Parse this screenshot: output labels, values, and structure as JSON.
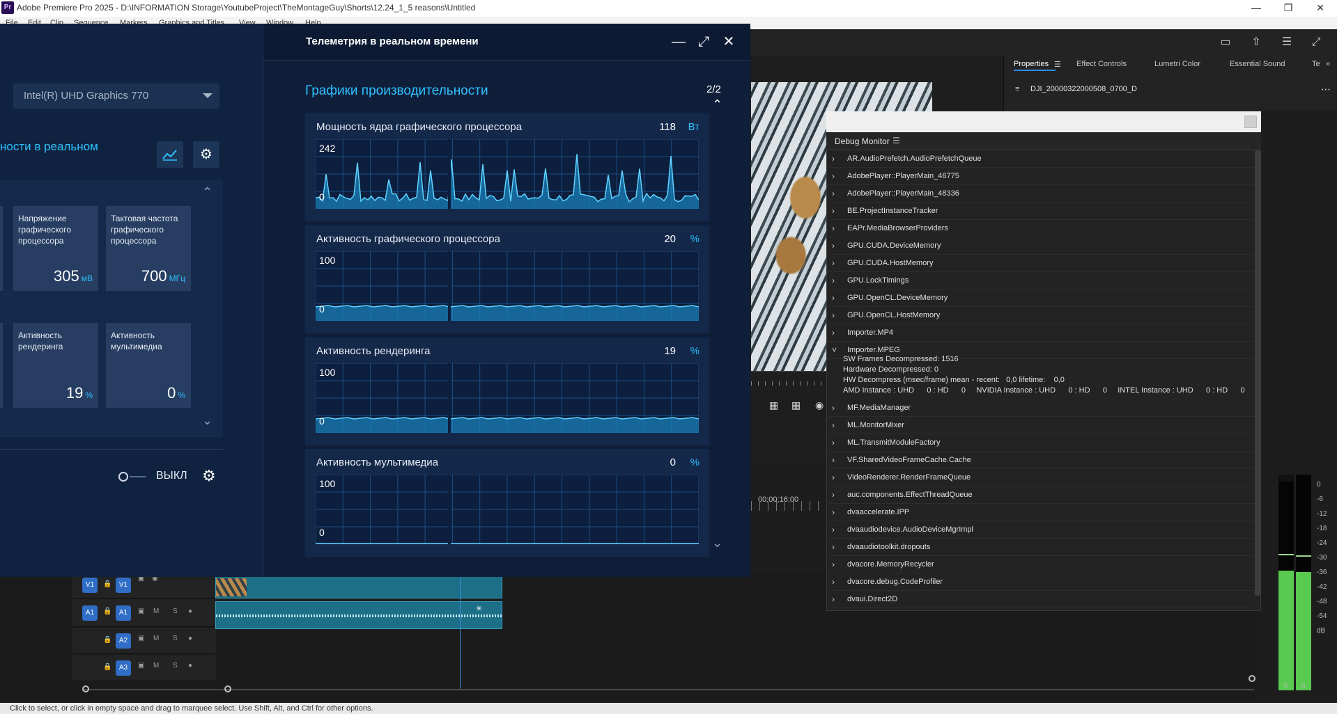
{
  "window": {
    "title": "Adobe Premiere Pro 2025 - D:\\INFORMATION Storage\\YoutubeProject\\TheMontageGuy\\Shorts\\12.24_1_5 reasons\\Untitled",
    "app_badge": "Pr"
  },
  "menu": [
    "File",
    "Edit",
    "Clip",
    "Sequence",
    "Markers",
    "Graphics and Titles",
    "View",
    "Window",
    "Help"
  ],
  "telemetry": {
    "window_title": "Телеметрия в реальном времени",
    "gpu_selected": "Intel(R) UHD Graphics 770",
    "left_subtitle": "ности в реальном",
    "metric_cards": [
      {
        "label": "Напряжение графического процессора",
        "value": "305",
        "unit": "мВ"
      },
      {
        "label": "Тактовая частота графического процессора",
        "value": "700",
        "unit": "МГц"
      },
      {
        "label": "Активность рендеринга",
        "value": "19",
        "unit": "%"
      },
      {
        "label": "Активность мультимедиа",
        "value": "0",
        "unit": "%"
      }
    ],
    "toggle_label": "ВЫКЛ",
    "perf_title": "Графики производительности",
    "page_indicator": "2/2",
    "graphs": [
      {
        "title": "Мощность ядра графического процессора",
        "value": "118",
        "unit": "Вт",
        "ymax": "242",
        "ymin": "0"
      },
      {
        "title": "Активность графического процессора",
        "value": "20",
        "unit": "%",
        "ymax": "100",
        "ymin": "0"
      },
      {
        "title": "Активность рендеринга",
        "value": "19",
        "unit": "%",
        "ymax": "100",
        "ymin": "0"
      },
      {
        "title": "Активность мультимедиа",
        "value": "0",
        "unit": "%",
        "ymax": "100",
        "ymin": "0"
      }
    ]
  },
  "properties": {
    "tabs": [
      "Properties",
      "Effect Controls",
      "Lumetri Color",
      "Essential Sound",
      "Te"
    ],
    "clip_name": "DJI_20000322000508_0700_D"
  },
  "debug": {
    "title": "Debug Monitor",
    "items_before": [
      "AR.AudioPrefetch.AudioPrefetchQueue",
      "AdobePlayer::PlayerMain_46775",
      "AdobePlayer::PlayerMain_48336",
      "BE.ProjectInstanceTracker",
      "EAPr.MediaBrowserProviders",
      "GPU.CUDA.DeviceMemory",
      "GPU.CUDA.HostMemory",
      "GPU.LockTimings",
      "GPU.OpenCL.DeviceMemory",
      "GPU.OpenCL.HostMemory",
      "Importer.MP4"
    ],
    "expanded_item": "Importer.MPEG",
    "expanded_details": [
      "SW Frames Decompressed: 1516",
      "Hardware Decompressed: 0",
      "HW Decompress (msec/frame) mean - recent:   0,0 lifetime:    0,0",
      "AMD Instance : UHD      0 : HD      0     NVIDIA Instance : UHD      0 : HD      0     INTEL Instance : UHD      0 : HD      0"
    ],
    "items_after": [
      "MF.MediaManager",
      "ML.MonitorMixer",
      "ML.TransmitModuleFactory",
      "VF.SharedVideoFrameCache.Cache",
      "VideoRenderer.RenderFrameQueue",
      "auc.components.EffectThreadQueue",
      "dvaaccelerate.IPP",
      "dvaaudiodevice.AudioDeviceMgrImpl",
      "dvaaudiotoolkit.dropouts",
      "dvacore.MemoryRecycler",
      "dvacore.debug.CodeProfiler",
      "dvaui.Direct2D"
    ]
  },
  "timeline": {
    "timecode": "00;00;16;00",
    "tracks": [
      {
        "left": "V1",
        "right": "V1"
      },
      {
        "left": "A1",
        "right": "A1"
      },
      {
        "left": "",
        "right": "A2"
      },
      {
        "left": "",
        "right": "A3"
      }
    ],
    "track_letters": [
      "M",
      "S"
    ]
  },
  "audio_meter": {
    "scale": [
      "0",
      "-6",
      "-12",
      "-18",
      "-24",
      "-30",
      "-36",
      "-42",
      "-48",
      "-54",
      "dB"
    ],
    "channels": [
      "S",
      "S"
    ]
  },
  "status_bar": "Click to select, or click in empty space and drag to marquee select. Use Shift, Alt, and Ctrl for other options."
}
